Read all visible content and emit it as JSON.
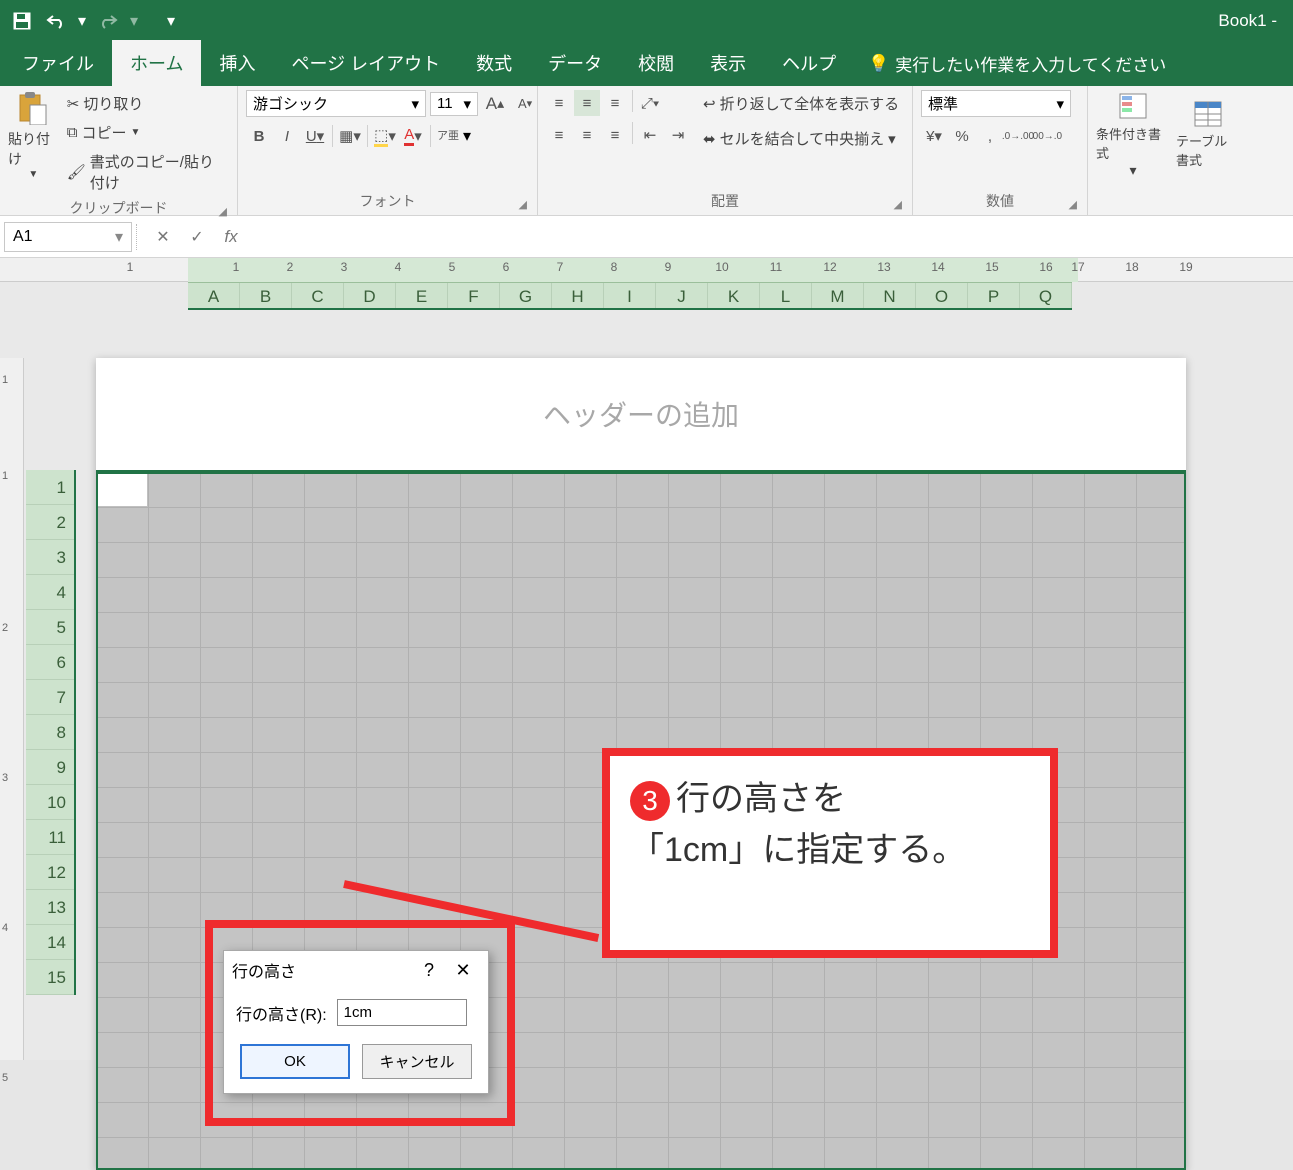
{
  "title": {
    "document": "Book1  -"
  },
  "qat": {
    "save": "保存",
    "undo": "元に戻す",
    "redo": "やり直し"
  },
  "tabs": {
    "file": "ファイル",
    "home": "ホーム",
    "insert": "挿入",
    "pageLayout": "ページ レイアウト",
    "formulas": "数式",
    "data": "データ",
    "review": "校閲",
    "view": "表示",
    "help": "ヘルプ",
    "tellMe": "実行したい作業を入力してください"
  },
  "ribbon": {
    "clipboard": {
      "paste": "貼り付け",
      "cut": "切り取り",
      "copy": "コピー",
      "formatPainter": "書式のコピー/貼り付け",
      "label": "クリップボード"
    },
    "font": {
      "name": "游ゴシック",
      "size": "11",
      "bold": "B",
      "italic": "I",
      "underline": "U",
      "ruby": "ア亜",
      "label": "フォント"
    },
    "alignment": {
      "wrap": "折り返して全体を表示する",
      "merge": "セルを結合して中央揃え",
      "label": "配置"
    },
    "number": {
      "format": "標準",
      "label": "数値"
    },
    "styles": {
      "conditional": "条件付き書式",
      "table": "テーブル書式"
    }
  },
  "formulaBar": {
    "nameBox": "A1",
    "fx": "fx"
  },
  "columns": [
    "A",
    "B",
    "C",
    "D",
    "E",
    "F",
    "G",
    "H",
    "I",
    "J",
    "K",
    "L",
    "M",
    "N",
    "O",
    "P",
    "Q"
  ],
  "rulerH": [
    "1",
    "1",
    "2",
    "3",
    "4",
    "5",
    "6",
    "7",
    "8",
    "9",
    "10",
    "11",
    "12",
    "13",
    "14",
    "15",
    "16",
    "17",
    "18",
    "19"
  ],
  "rulerV": [
    "1",
    "1",
    "2",
    "3",
    "4",
    "5"
  ],
  "rows": [
    "1",
    "2",
    "3",
    "4",
    "5",
    "6",
    "7",
    "8",
    "9",
    "10",
    "11",
    "12",
    "13",
    "14",
    "15"
  ],
  "page": {
    "headerPlaceholder": "ヘッダーの追加"
  },
  "dialog": {
    "title": "行の高さ",
    "label": "行の高さ(R):",
    "value": "1cm",
    "ok": "OK",
    "cancel": "キャンセル"
  },
  "callout": {
    "num": "3",
    "line1": "行の高さを",
    "line2": "「1cm」に指定する。"
  }
}
